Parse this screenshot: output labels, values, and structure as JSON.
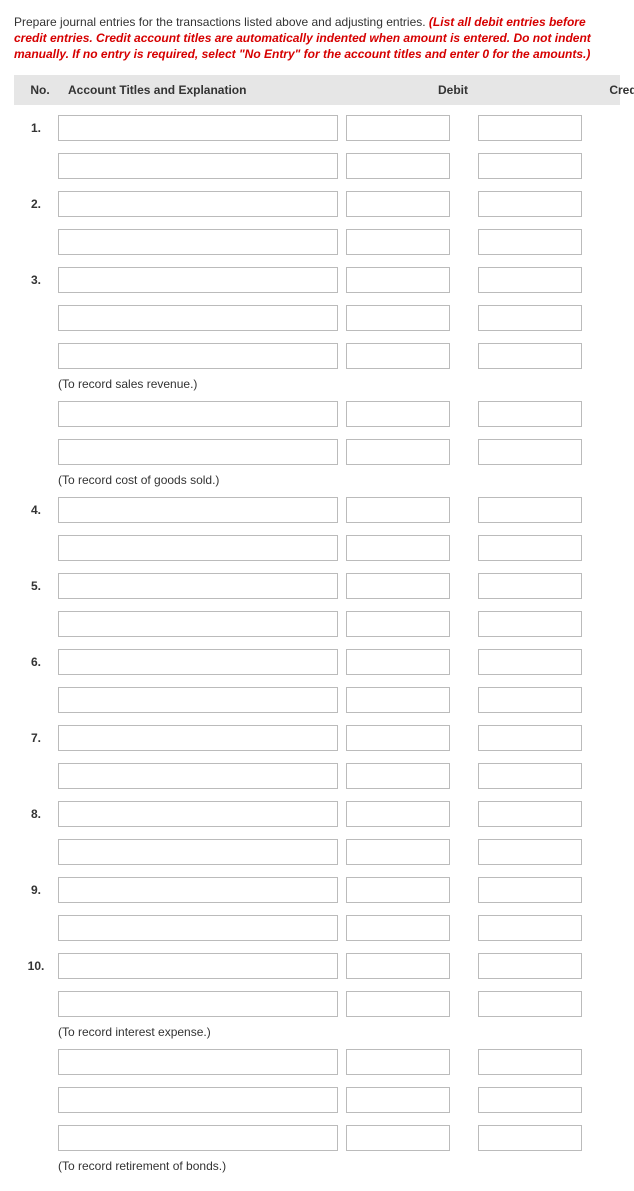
{
  "instructions": {
    "plain": "Prepare journal entries for the transactions listed above and adjusting entries. ",
    "emphasis": "(List all debit entries before credit entries. Credit account titles are automatically indented when amount is entered. Do not indent manually. If no entry is required, select \"No Entry\" for the account titles and enter 0 for the amounts.)"
  },
  "headers": {
    "no": "No.",
    "account": "Account Titles and Explanation",
    "debit": "Debit",
    "credit": "Credit"
  },
  "rows": [
    {
      "type": "input",
      "num": "1."
    },
    {
      "type": "input",
      "num": ""
    },
    {
      "type": "input",
      "num": "2."
    },
    {
      "type": "input",
      "num": ""
    },
    {
      "type": "input",
      "num": "3."
    },
    {
      "type": "input",
      "num": ""
    },
    {
      "type": "input",
      "num": ""
    },
    {
      "type": "caption",
      "text": "(To record sales revenue.)"
    },
    {
      "type": "input",
      "num": ""
    },
    {
      "type": "input",
      "num": ""
    },
    {
      "type": "caption",
      "text": "(To record cost of goods sold.)"
    },
    {
      "type": "input",
      "num": "4."
    },
    {
      "type": "input",
      "num": ""
    },
    {
      "type": "input",
      "num": "5."
    },
    {
      "type": "input",
      "num": ""
    },
    {
      "type": "input",
      "num": "6."
    },
    {
      "type": "input",
      "num": ""
    },
    {
      "type": "input",
      "num": "7."
    },
    {
      "type": "input",
      "num": ""
    },
    {
      "type": "input",
      "num": "8."
    },
    {
      "type": "input",
      "num": ""
    },
    {
      "type": "input",
      "num": "9."
    },
    {
      "type": "input",
      "num": ""
    },
    {
      "type": "input",
      "num": "10."
    },
    {
      "type": "input",
      "num": ""
    },
    {
      "type": "caption",
      "text": "(To record interest expense.)"
    },
    {
      "type": "input",
      "num": ""
    },
    {
      "type": "input",
      "num": ""
    },
    {
      "type": "input",
      "num": ""
    },
    {
      "type": "caption",
      "text": "(To record retirement of bonds.)"
    }
  ]
}
